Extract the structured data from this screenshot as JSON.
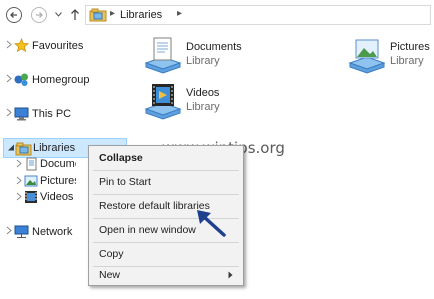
{
  "address_bar": {
    "crumb": "Libraries"
  },
  "nav_pane": {
    "items": [
      {
        "label": "Favourites"
      },
      {
        "label": "Homegroup"
      },
      {
        "label": "This PC"
      },
      {
        "label": "Libraries"
      },
      {
        "label": "Network"
      }
    ],
    "library_children": [
      {
        "label": "Documents"
      },
      {
        "label": "Pictures"
      },
      {
        "label": "Videos"
      }
    ]
  },
  "content": {
    "tiles": [
      {
        "name": "Documents",
        "type": "Library",
        "icon": "documents-library-icon"
      },
      {
        "name": "Pictures",
        "type": "Library",
        "icon": "pictures-library-icon"
      },
      {
        "name": "Videos",
        "type": "Library",
        "icon": "videos-library-icon"
      }
    ]
  },
  "context_menu": {
    "items": [
      {
        "label": "Collapse"
      },
      {
        "label": "Pin to Start"
      },
      {
        "label": "Restore default libraries"
      },
      {
        "label": "Open in new window"
      },
      {
        "label": "Copy"
      },
      {
        "label": "New"
      }
    ]
  },
  "watermark": "www.wintips.org",
  "colors": {
    "selection_bg": "#cce8ff",
    "selection_border": "#99d1ff",
    "menu_bg": "#f2f2f2",
    "pointer": "#1f3f8f"
  }
}
